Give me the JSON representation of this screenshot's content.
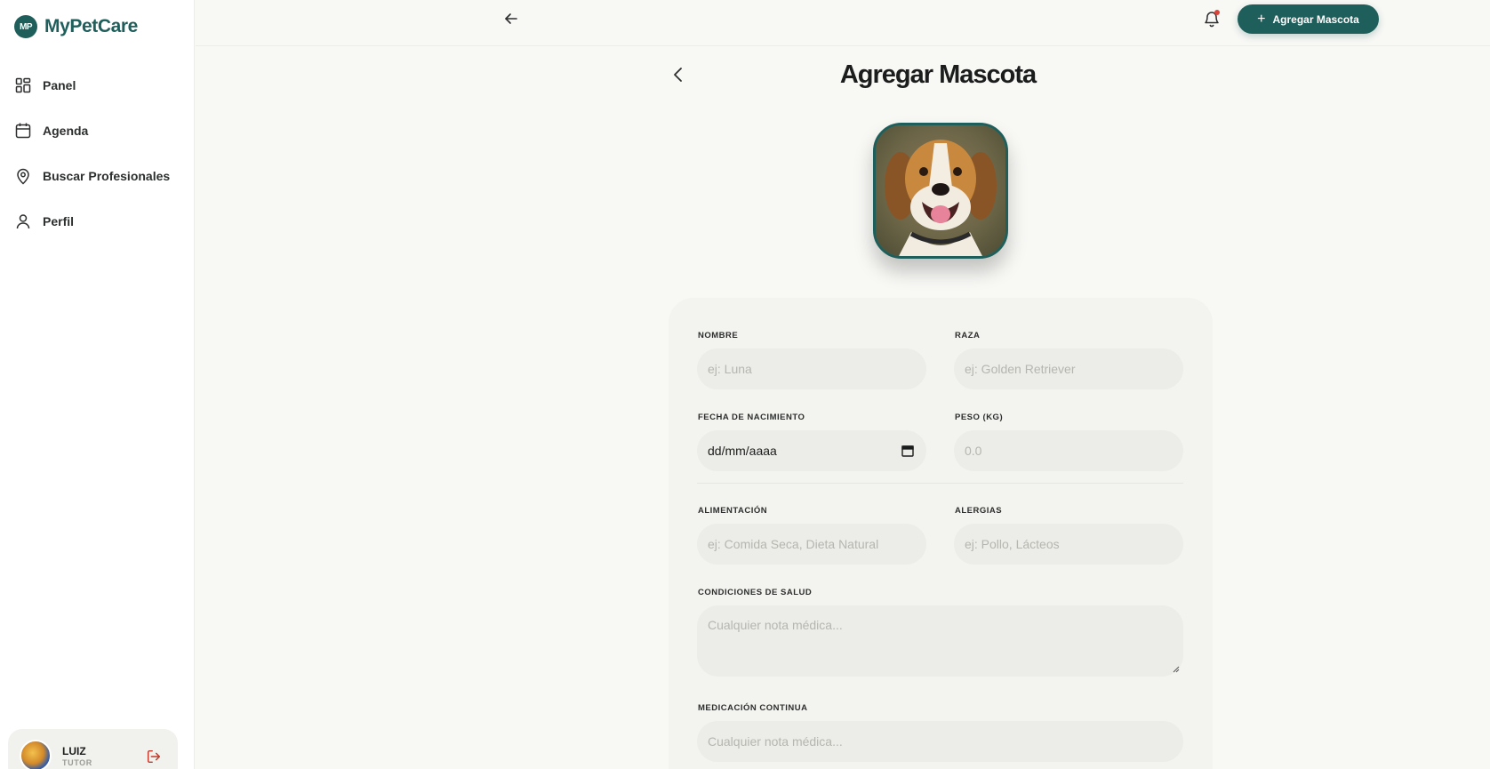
{
  "app": {
    "logo_badge": "MP",
    "name": "MyPetCare"
  },
  "sidebar": {
    "items": [
      {
        "label": "Panel",
        "icon": "dashboard-icon"
      },
      {
        "label": "Agenda",
        "icon": "calendar-icon"
      },
      {
        "label": "Buscar Profesionales",
        "icon": "map-pin-icon"
      },
      {
        "label": "Perfil",
        "icon": "user-icon"
      }
    ]
  },
  "user": {
    "name": "LUIZ",
    "role": "TUTOR"
  },
  "topbar": {
    "add_button_label": "Agregar Mascota",
    "notification_indicator": true
  },
  "page": {
    "title": "Agregar Mascota"
  },
  "form": {
    "nombre": {
      "label": "NOMBRE",
      "placeholder": "ej: Luna",
      "value": ""
    },
    "raza": {
      "label": "RAZA",
      "placeholder": "ej: Golden Retriever",
      "value": ""
    },
    "fecha": {
      "label": "FECHA DE NACIMIENTO",
      "value": "dd/mm/aaaa"
    },
    "peso": {
      "label": "PESO (KG)",
      "placeholder": "0.0",
      "value": ""
    },
    "alimentacion": {
      "label": "ALIMENTACIÓN",
      "placeholder": "ej: Comida Seca, Dieta Natural",
      "value": ""
    },
    "alergias": {
      "label": "ALERGIAS",
      "placeholder": "ej: Pollo, Lácteos",
      "value": ""
    },
    "condiciones": {
      "label": "CONDICIONES DE SALUD",
      "placeholder": "Cualquier nota médica...",
      "value": ""
    },
    "medicacion": {
      "label": "MEDICACIÓN CONTINUA",
      "placeholder": "Cualquier nota médica...",
      "value": ""
    }
  },
  "colors": {
    "brand": "#1f5f5b",
    "background": "#f8f8f5",
    "field_bg": "#ecece8",
    "notification": "#d9443a"
  }
}
